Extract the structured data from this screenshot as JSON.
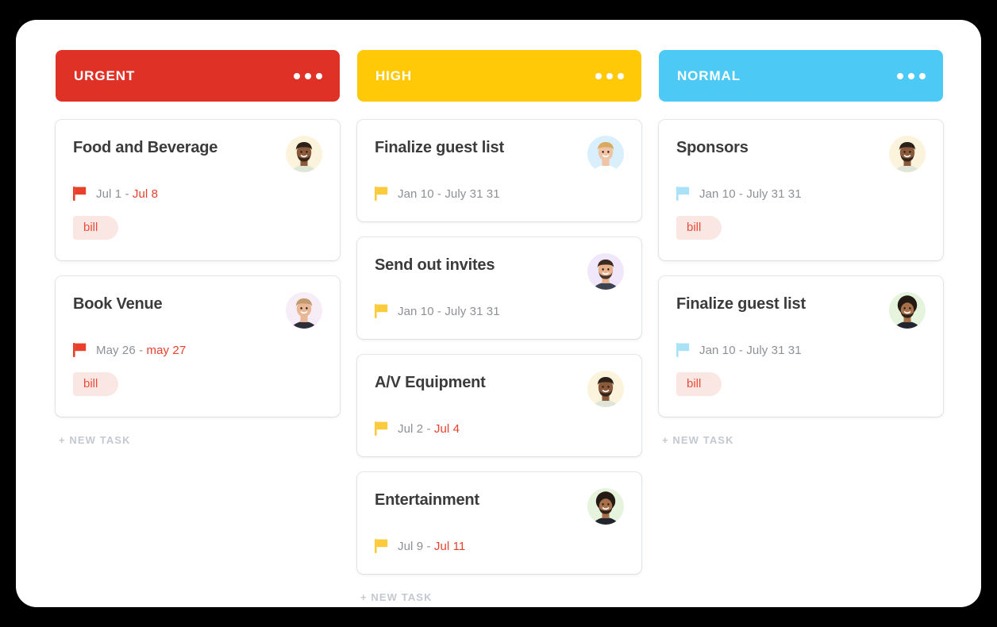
{
  "board": {
    "panel_bg": "#ffffff",
    "page_bg": "#000000",
    "columns": [
      {
        "id": "urgent",
        "title": "URGENT",
        "header_color": "#e03127",
        "flag_color": "#e8402a",
        "menu_icon": "ellipsis-horizontal-icon",
        "new_task_label": "+ NEW TASK",
        "cards": [
          {
            "title": "Food and Beverage",
            "flag_icon": "flag-icon",
            "flag_color": "#e8402a",
            "date_start": "Jul 1",
            "date_separator": "-",
            "date_end": "Jul 8",
            "date_end_overdue": true,
            "tag": "bill",
            "tag_bg": "#fae7e3",
            "tag_color": "#ea4d3a",
            "avatar_name": "avatar",
            "avatar_bg": "#fbf3dc",
            "avatar_skin": "#8a5a3b",
            "avatar_hair": "#2c2018",
            "avatar_shirt": "#dfe6d8",
            "avatar_beard": true,
            "avatar_afro": false
          },
          {
            "title": "Book Venue",
            "flag_icon": "flag-icon",
            "flag_color": "#e8402a",
            "date_start": "May 26",
            "date_separator": "-",
            "date_end": "may 27",
            "date_end_overdue": true,
            "tag": "bill",
            "tag_bg": "#fae7e3",
            "tag_color": "#ea4d3a",
            "avatar_name": "avatar",
            "avatar_bg": "#f6edf7",
            "avatar_skin": "#e8b795",
            "avatar_hair": "#c39a6b",
            "avatar_shirt": "#2e2e38",
            "avatar_beard": false,
            "avatar_afro": false
          }
        ]
      },
      {
        "id": "high",
        "title": "HIGH",
        "header_color": "#ffc907",
        "flag_color": "#fbcb3c",
        "menu_icon": "ellipsis-horizontal-icon",
        "new_task_label": "+ NEW TASK",
        "cards": [
          {
            "title": "Finalize guest list",
            "flag_icon": "flag-icon",
            "flag_color": "#fbcb3c",
            "date_start": "Jan 10",
            "date_separator": "-",
            "date_end": "July 31 31",
            "date_end_overdue": false,
            "tag": null,
            "avatar_name": "avatar",
            "avatar_bg": "#d9effb",
            "avatar_skin": "#f0c3a4",
            "avatar_hair": "#d8a95f",
            "avatar_shirt": "#ffffff",
            "avatar_beard": false,
            "avatar_afro": false
          },
          {
            "title": "Send out invites",
            "flag_icon": "flag-icon",
            "flag_color": "#fbcb3c",
            "date_start": "Jan 10",
            "date_separator": "-",
            "date_end": "July 31 31",
            "date_end_overdue": false,
            "tag": null,
            "avatar_name": "avatar",
            "avatar_bg": "#f1e7fa",
            "avatar_skin": "#e8b18c",
            "avatar_hair": "#3a2b22",
            "avatar_shirt": "#3d4450",
            "avatar_beard": true,
            "avatar_afro": false
          },
          {
            "title": "A/V Equipment",
            "flag_icon": "flag-icon",
            "flag_color": "#fbcb3c",
            "date_start": "Jul 2",
            "date_separator": "-",
            "date_end": "Jul 4",
            "date_end_overdue": true,
            "tag": null,
            "avatar_name": "avatar",
            "avatar_bg": "#fbf3dc",
            "avatar_skin": "#8a5a3b",
            "avatar_hair": "#2c2018",
            "avatar_shirt": "#dfe6d8",
            "avatar_beard": true,
            "avatar_afro": false
          },
          {
            "title": "Entertainment",
            "flag_icon": "flag-icon",
            "flag_color": "#fbcb3c",
            "date_start": "Jul 9",
            "date_separator": "-",
            "date_end": "Jul 11",
            "date_end_overdue": true,
            "tag": null,
            "avatar_name": "avatar",
            "avatar_bg": "#e6f3dd",
            "avatar_skin": "#a8704a",
            "avatar_hair": "#241a14",
            "avatar_shirt": "#20252e",
            "avatar_beard": true,
            "avatar_afro": true
          }
        ]
      },
      {
        "id": "normal",
        "title": "NORMAL",
        "header_color": "#4dc9f6",
        "flag_color": "#a9e2f7",
        "menu_icon": "ellipsis-horizontal-icon",
        "new_task_label": "+ NEW TASK",
        "cards": [
          {
            "title": "Sponsors",
            "flag_icon": "flag-icon",
            "flag_color": "#a9e2f7",
            "date_start": "Jan 10",
            "date_separator": "-",
            "date_end": "July 31 31",
            "date_end_overdue": false,
            "tag": "bill",
            "tag_bg": "#fae7e3",
            "tag_color": "#ea4d3a",
            "avatar_name": "avatar",
            "avatar_bg": "#fbf3dc",
            "avatar_skin": "#8a5a3b",
            "avatar_hair": "#2c2018",
            "avatar_shirt": "#dfe6d8",
            "avatar_beard": true,
            "avatar_afro": false
          },
          {
            "title": "Finalize guest list",
            "flag_icon": "flag-icon",
            "flag_color": "#a9e2f7",
            "date_start": "Jan 10",
            "date_separator": "-",
            "date_end": "July 31 31",
            "date_end_overdue": false,
            "tag": "bill",
            "tag_bg": "#fae7e3",
            "tag_color": "#ea4d3a",
            "avatar_name": "avatar",
            "avatar_bg": "#e6f3dd",
            "avatar_skin": "#a8704a",
            "avatar_hair": "#241a14",
            "avatar_shirt": "#20252e",
            "avatar_beard": true,
            "avatar_afro": true
          }
        ]
      }
    ]
  }
}
